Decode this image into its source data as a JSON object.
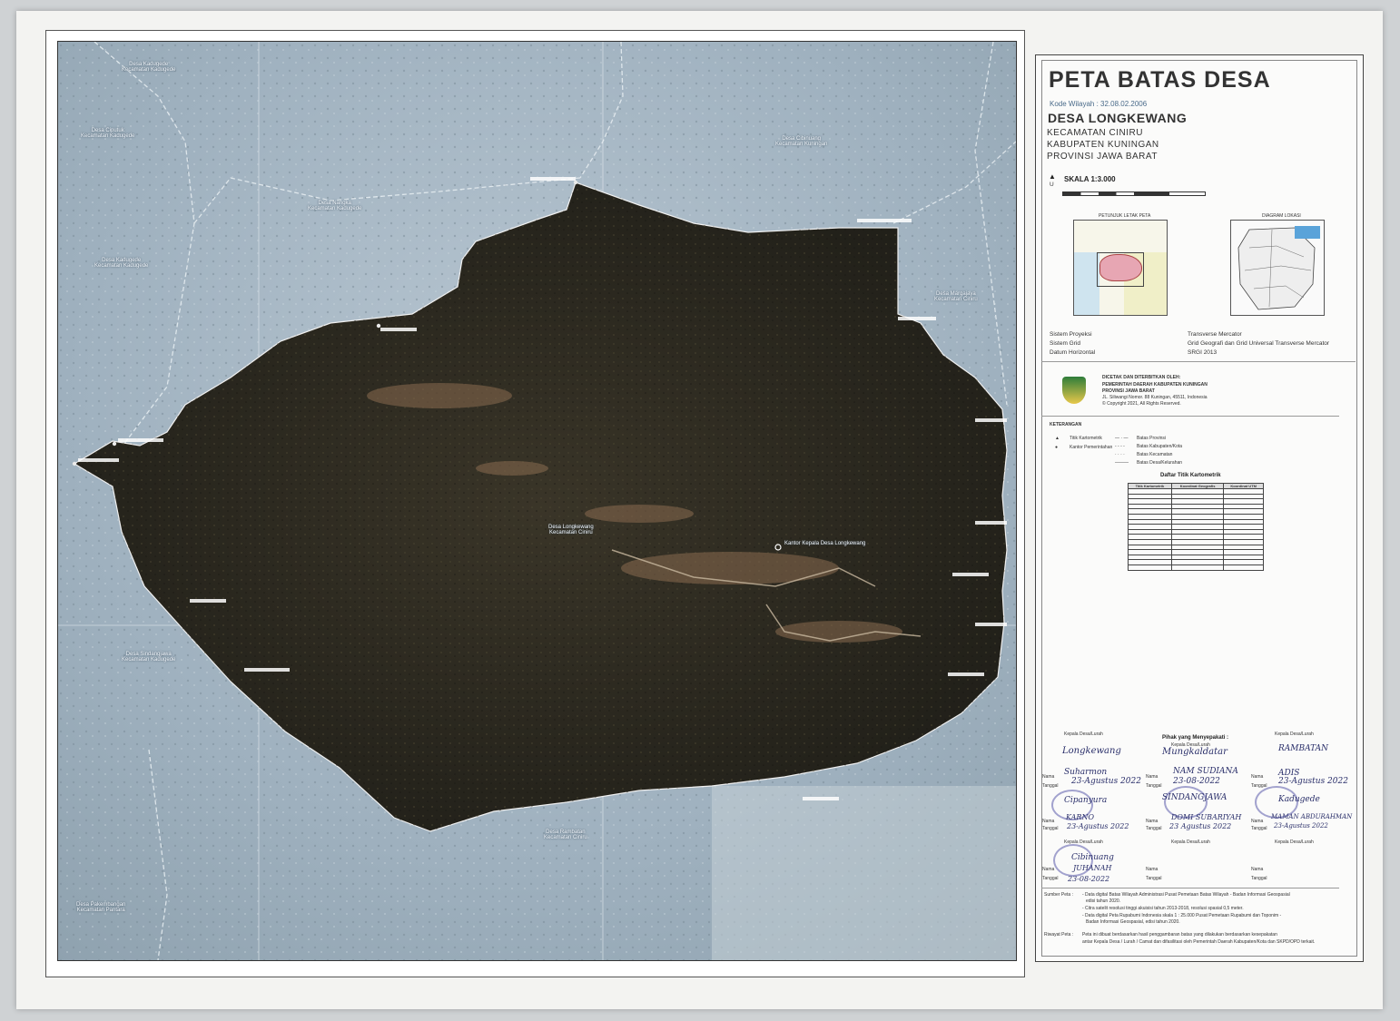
{
  "panel": {
    "title": "PETA BATAS DESA",
    "kode": "Kode Wilayah : 32.08.02.2006",
    "desa": "DESA LONGKEWANG",
    "kecamatan": "KECAMATAN CINIRU",
    "kabupaten": "KABUPATEN KUNINGAN",
    "provinsi": "PROVINSI JAWA BARAT",
    "skala": "SKALA 1:3.000",
    "north": "U",
    "inset_left_title": "PETUNJUK LETAK PETA",
    "inset_right_title": "DIAGRAM LOKASI",
    "sistem_proyeksi_label": "Sistem Proyeksi",
    "sistem_proyeksi": "Transverse Mercator",
    "sistem_grid_label": "Sistem Grid",
    "sistem_grid": "Grid Geografi dan Grid Universal Transverse Mercator",
    "datum_label": "Datum Horizontal",
    "datum": "SRGI 2013",
    "publisher_1": "DICETAK DAN DITERBITKAN OLEH:",
    "publisher_2": "PEMERINTAH DAERAH KABUPATEN KUNINGAN",
    "publisher_3": "PROVINSI JAWA BARAT",
    "publisher_4": "JL. Siliwangi Nomor. 88 Kuningan, 45511, Indonesia",
    "publisher_5": "© Copyright 2021, All Rights Reserved.",
    "keterangan": "KETERANGAN",
    "legend_left": [
      "Titik Kartometrik",
      "Kantor Pemerintahan"
    ],
    "legend_right": [
      "Batas Provinsi",
      "Batas Kabupaten/Kota",
      "Batas Kecamatan",
      "Batas Desa/Kelurahan"
    ],
    "daftar_title": "Daftar Titik Kartometrik",
    "table_headers": [
      "Titik Kartometrik",
      "Koordinat Geografis",
      "Koordinat UTM"
    ],
    "pihak": "Pihak yang Menyepakati :",
    "kepala_label": "Kepala Desa/Lurah",
    "nama_label": "Nama",
    "tanggal_label": "Tanggal",
    "signers": [
      {
        "village": "Longkewang",
        "name": "Suharmon",
        "date": "23-Agustus 2022"
      },
      {
        "village": "Mungkaldatar",
        "name": "NAM SUDIANA",
        "date": "23-08-2022"
      },
      {
        "village": "RAMBATAN",
        "name": "ADIS",
        "date": "23-Agustus 2022"
      },
      {
        "village": "Cipanyura",
        "name": "KARNO",
        "date": "23-Agustus 2022"
      },
      {
        "village": "SINDANGJAWA",
        "name": "DOMI SUBARIYAH",
        "date": "23 Agustus 2022"
      },
      {
        "village": "Kadugede",
        "name": "MAMAN ABDURAHMAN",
        "date": "23-Agustus 2022"
      },
      {
        "village": "Cibinuang",
        "name": "JUHANAH",
        "date": "23-08-2022"
      }
    ],
    "sumber_label": "Sumber Peta :",
    "sumber_1": "- Data digital Batas Wilayah Administrasi Pusat Pemetaan Batas Wilayah - Badan Informasi Geospasial",
    "sumber_1b": "edisi tahun 2020.",
    "sumber_2": "- Citra satelit resolusi tinggi akuisisi tahun 2013-2018, resolusi spasial 0,5 meter.",
    "sumber_3": "- Data digital Peta Rupabumi Indonesia skala 1 : 25.000 Pusat Pemetaan Rupabumi dan Toponim -",
    "sumber_3b": "Badan Informasi Geospasial, edisi tahun 2020.",
    "riwayat_label": "Riwayat Peta :",
    "riwayat_1": "Peta ini dibuat berdasarkan hasil penggambaran batas yang dilakukan berdasarkan kesepakatan",
    "riwayat_2": "antar Kepala Desa / Lurah / Camat dan difasilitasi oleh Pemerintah Daerah Kabupaten/Kota dan SKPD/OPD terkait."
  },
  "map_labels": [
    {
      "name": "Desa Kadugede",
      "sub": "Kecamatan Kadugede"
    },
    {
      "name": "Desa Ciputuk",
      "sub": "Kecamatan Kadugede"
    },
    {
      "name": "Desa Cibinuang",
      "sub": "Kecamatan Kuningan"
    },
    {
      "name": "Desa Nangka",
      "sub": "Kecamatan Kadugede"
    },
    {
      "name": "Desa Kadugede",
      "sub": "Kecamatan Kadugede"
    },
    {
      "name": "Desa Margajaya",
      "sub": "Kecamatan Ciniru"
    },
    {
      "name": "Desa Longkewang",
      "sub": "Kecamatan Ciniru"
    },
    {
      "name": "Kantor Kepala Desa Longkewang",
      "sub": ""
    },
    {
      "name": "Desa Sindangjawa",
      "sub": "Kecamatan Kadugede"
    },
    {
      "name": "Desa Rambatan",
      "sub": "Kecamatan Ciniru"
    },
    {
      "name": "Desa Pakembangan",
      "sub": "Kecamatan Pantara"
    }
  ],
  "colors": {
    "terrain": "#a9b9c6",
    "village": "#2b2a22",
    "panel_title": "#333333"
  }
}
